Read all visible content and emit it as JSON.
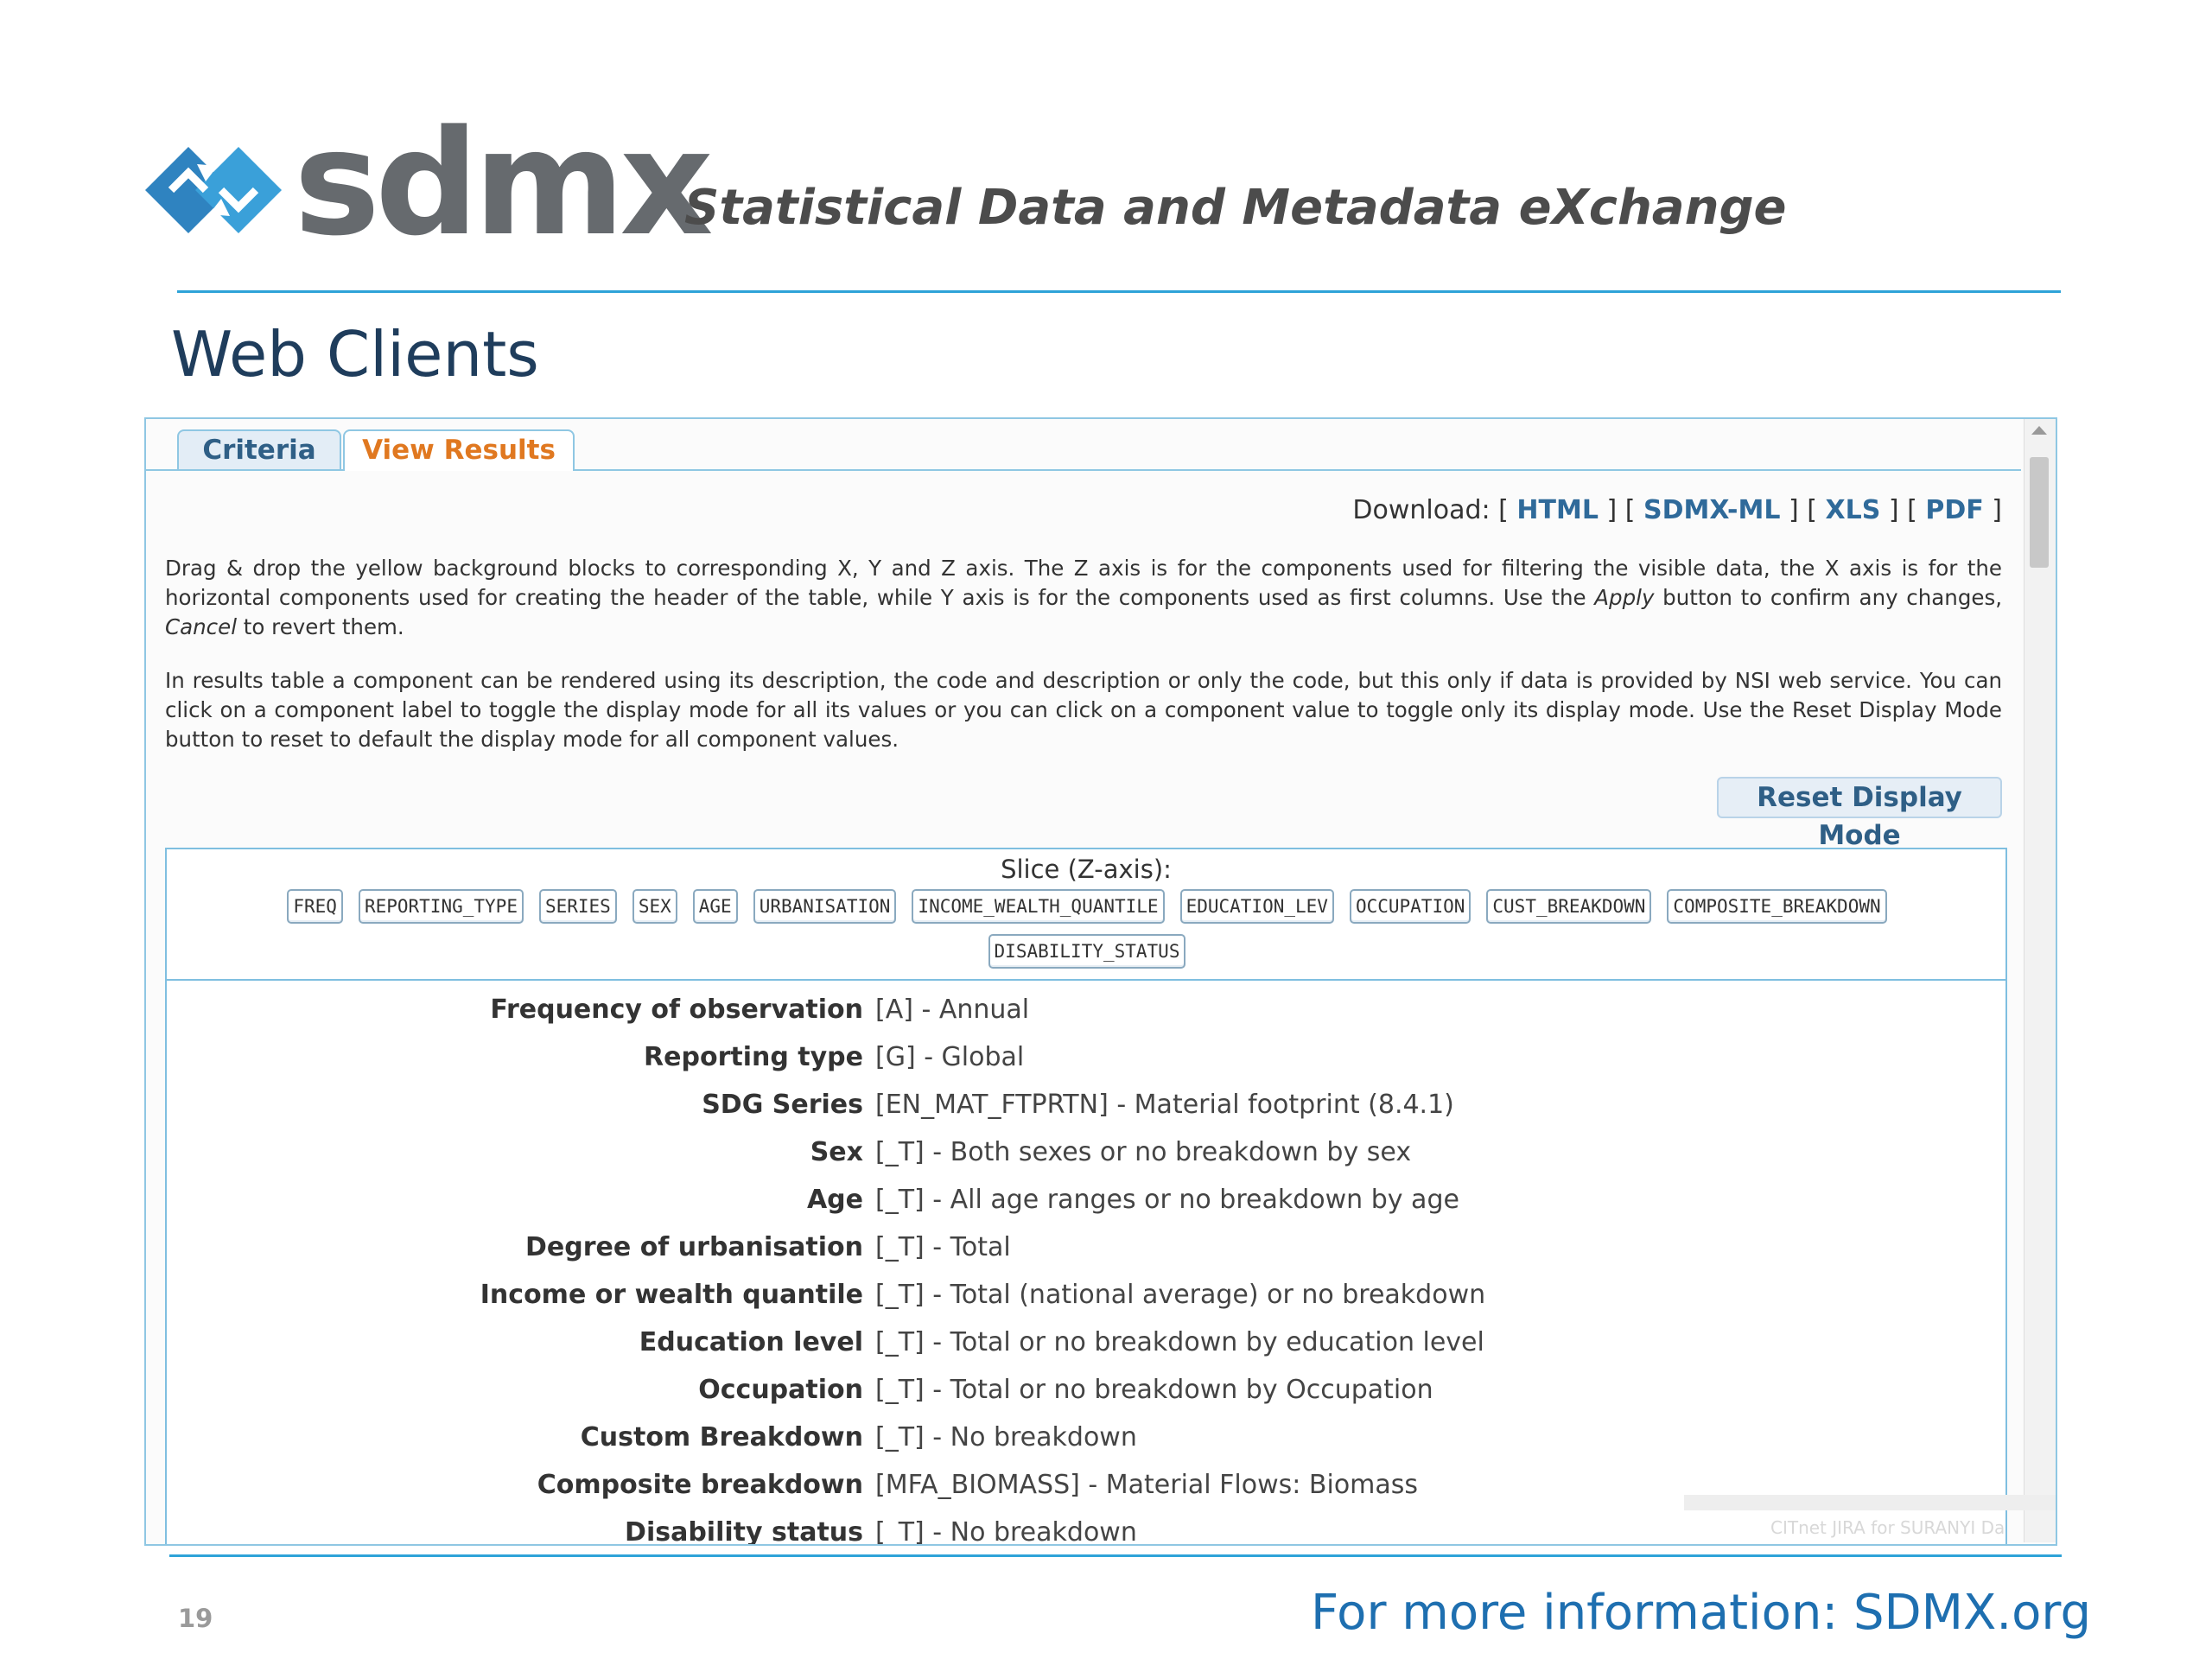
{
  "header": {
    "logo_word": "sdmx",
    "tagline": "Statistical Data and Metadata eXchange",
    "slide_title": "Web Clients"
  },
  "tabs": [
    {
      "label": "Criteria",
      "active": false
    },
    {
      "label": "View Results",
      "active": true
    }
  ],
  "download": {
    "label": "Download:",
    "links": [
      "HTML",
      "SDMX-ML",
      "XLS",
      "PDF"
    ]
  },
  "instructions": {
    "p1_a": "Drag & drop the yellow background blocks to corresponding X, Y and Z axis. The Z axis is for the components used for filtering the visible data, the X axis is for the horizontal components used for creating the header of the table, while Y axis is for the components used as first columns. Use the ",
    "p1_apply": "Apply",
    "p1_b": " button to confirm any changes, ",
    "p1_cancel": "Cancel",
    "p1_c": " to revert them.",
    "p2": "In results table a component can be rendered using its description, the code and description or only the code, but this only if data is provided by NSI web service. You can click on a component label to toggle the display mode for all its values or you can click on a component value to toggle only its display mode. Use the Reset Display Mode button to reset to default the display mode for all component values."
  },
  "reset_button": "Reset Display Mode",
  "slice": {
    "title": "Slice (Z-axis):",
    "chips": [
      "FREQ",
      "REPORTING_TYPE",
      "SERIES",
      "SEX",
      "AGE",
      "URBANISATION",
      "INCOME_WEALTH_QUANTILE",
      "EDUCATION_LEV",
      "OCCUPATION",
      "CUST_BREAKDOWN",
      "COMPOSITE_BREAKDOWN",
      "DISABILITY_STATUS"
    ]
  },
  "rows": [
    {
      "label": "Frequency of observation",
      "value": "[A] - Annual"
    },
    {
      "label": "Reporting type",
      "value": "[G] - Global"
    },
    {
      "label": "SDG Series",
      "value": "[EN_MAT_FTPRTN] - Material footprint (8.4.1)"
    },
    {
      "label": "Sex",
      "value": "[_T] - Both sexes or no breakdown by sex"
    },
    {
      "label": "Age",
      "value": "[_T] - All age ranges or no breakdown by age"
    },
    {
      "label": "Degree of urbanisation",
      "value": "[_T] - Total"
    },
    {
      "label": "Income or wealth quantile",
      "value": "[_T] - Total (national average) or no breakdown"
    },
    {
      "label": "Education level",
      "value": "[_T] - Total or no breakdown by education level"
    },
    {
      "label": "Occupation",
      "value": "[_T] - Total or no breakdown by Occupation"
    },
    {
      "label": "Custom Breakdown",
      "value": "[_T] - No breakdown"
    },
    {
      "label": "Composite breakdown",
      "value": "[MFA_BIOMASS] - Material Flows: Biomass"
    },
    {
      "label": "Disability status",
      "value": "[_T] - No breakdown"
    }
  ],
  "ghost_notification": "CITnet JIRA for SURANYI Da",
  "footer": {
    "page_number": "19",
    "more_info": "For more information: SDMX.org"
  },
  "colors": {
    "accent": "#2ea3d8",
    "title": "#1f3d5c",
    "active_tab": "#e07820",
    "link": "#2f6a9a",
    "footer_link": "#1e6fb0"
  }
}
